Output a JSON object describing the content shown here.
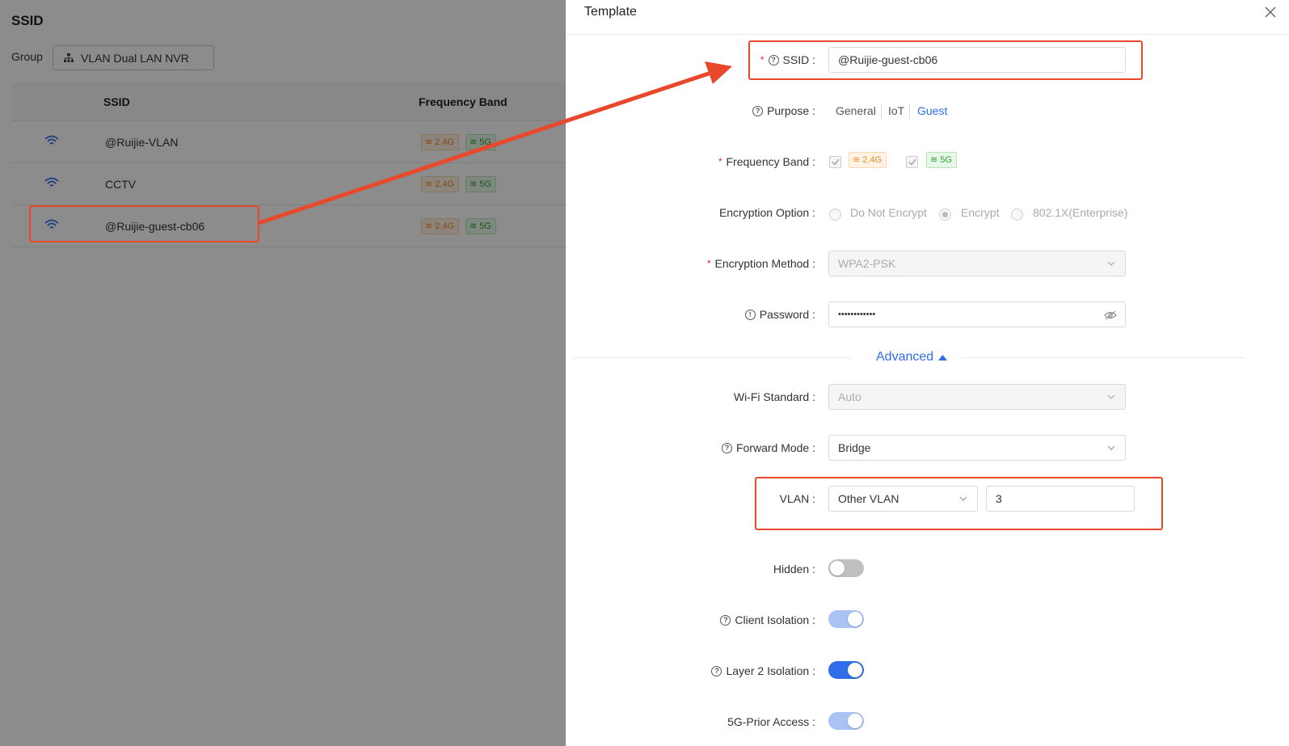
{
  "background": {
    "title": "SSID",
    "group_label": "Group",
    "group_value": "VLAN Dual LAN NVR",
    "columns": [
      "SSID",
      "Frequency Band"
    ],
    "rows": [
      {
        "name": "@Ruijie-VLAN",
        "band_24": "2.4G",
        "band_5": "5G"
      },
      {
        "name": "CCTV",
        "band_24": "2.4G",
        "band_5": "5G"
      },
      {
        "name": "@Ruijie-guest-cb06",
        "band_24": "2.4G",
        "band_5": "5G"
      }
    ]
  },
  "drawer": {
    "title": "Template",
    "ssid_label": "SSID :",
    "ssid_value": "@Ruijie-guest-cb06",
    "purpose_label": "Purpose :",
    "purpose_options": [
      "General",
      "IoT",
      "Guest"
    ],
    "purpose_selected": "Guest",
    "freq_label": "Frequency Band :",
    "freq_24": "2.4G",
    "freq_5": "5G",
    "enc_option_label": "Encryption Option :",
    "enc_options": [
      "Do Not Encrypt",
      "Encrypt",
      "802.1X(Enterprise)"
    ],
    "enc_selected": "Encrypt",
    "enc_method_label": "Encryption Method :",
    "enc_method_value": "WPA2-PSK",
    "password_label": "Password :",
    "password_value": "••••••••••••",
    "advanced_label": "Advanced",
    "wifi_std_label": "Wi-Fi Standard :",
    "wifi_std_value": "Auto",
    "forward_label": "Forward Mode :",
    "forward_value": "Bridge",
    "vlan_label": "VLAN :",
    "vlan_type": "Other VLAN",
    "vlan_id": "3",
    "hidden_label": "Hidden :",
    "hidden_on": false,
    "client_iso_label": "Client Isolation :",
    "client_iso_on": true,
    "l2_iso_label": "Layer 2 Isolation :",
    "l2_iso_on": true,
    "prior5g_label": "5G-Prior Access :",
    "prior5g_on": true
  },
  "colors": {
    "accent": "#2f6ee8",
    "highlight": "#e8482c",
    "tag_24": "#f08a24",
    "tag_5": "#33a033"
  }
}
